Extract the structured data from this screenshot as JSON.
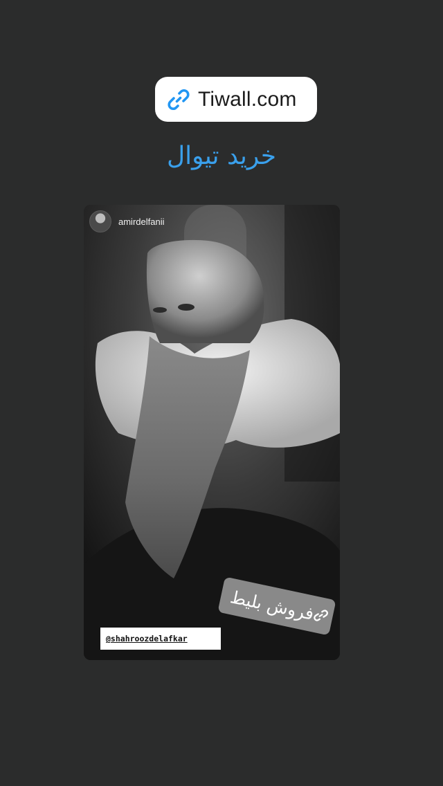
{
  "link_sticker": {
    "label": "Tiwall.com",
    "icon": "link-icon",
    "accent": "#2196f3"
  },
  "headline": {
    "text": "خرید تیوال",
    "color": "#3aa0ec"
  },
  "post": {
    "username": "amirdelfanii",
    "mention": "@shahroozdelafkar"
  },
  "sale_sticker": {
    "label": "فروش بلیط",
    "icon": "link-icon"
  },
  "colors": {
    "background": "#2b2c2c"
  }
}
